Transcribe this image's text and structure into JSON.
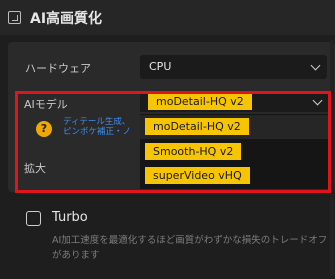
{
  "panel": {
    "title": "AI高画質化"
  },
  "hardware": {
    "label": "ハードウェア",
    "value": "CPU"
  },
  "ai_model": {
    "label": "AIモデル",
    "selected": "moDetail-HQ  v2",
    "description_line1": "ディテール生成、",
    "description_line2": "ピンボケ補正・ノ",
    "options": [
      "moDetail-HQ  v2",
      "Smooth-HQ  v2",
      "superVideo vHQ"
    ]
  },
  "scale": {
    "label": "拡大"
  },
  "turbo": {
    "label": "Turbo",
    "checked": false,
    "description": "AI加工速度を最適化するほど画質がわずかな損失のトレードオフがあります"
  },
  "colors": {
    "accent_tag": "#f7c400",
    "highlight": "#e0141c",
    "link": "#3f8ef0"
  },
  "icons": [
    "collapse-icon",
    "chevron-down-icon",
    "help-icon",
    "checkbox"
  ]
}
